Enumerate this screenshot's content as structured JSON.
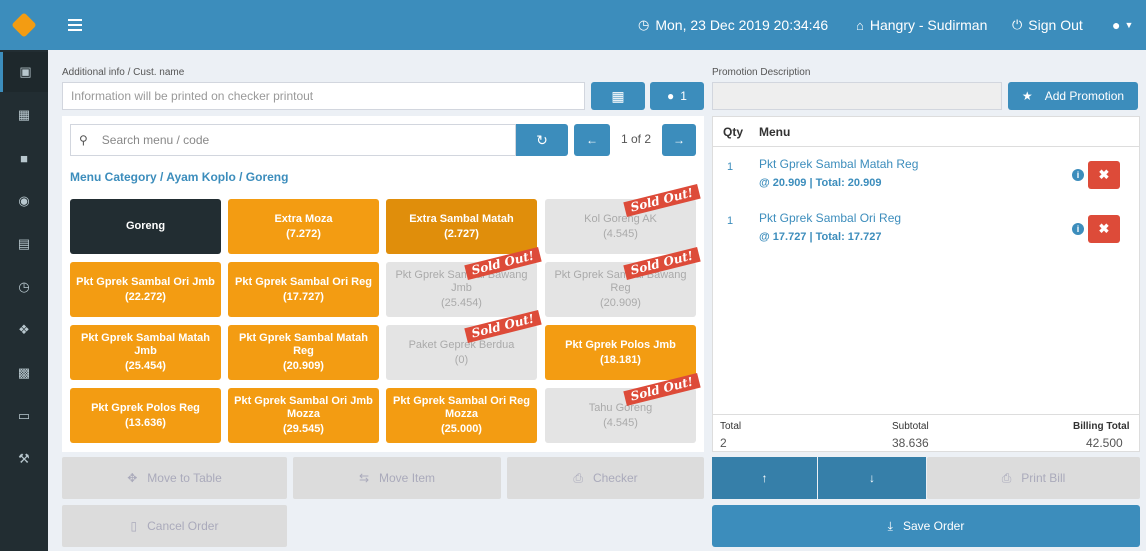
{
  "header": {
    "datetime": "Mon, 23 Dec 2019 20:34:46",
    "store": "Hangry - Sudirman",
    "signout": "Sign Out"
  },
  "sidebar_icons": [
    "table-icon",
    "keyboard-icon",
    "book-icon",
    "camera-icon",
    "card-icon",
    "clock-icon",
    "tag-icon",
    "receipt-icon",
    "inbox-icon",
    "wrench-icon"
  ],
  "customer": {
    "label": "Additional info / Cust. name",
    "placeholder": "Information will be printed on checker printout",
    "guest_count": "1"
  },
  "promotion": {
    "label": "Promotion Description",
    "add_label": "Add Promotion"
  },
  "search": {
    "placeholder": "Search menu / code",
    "page": "1 of 2"
  },
  "breadcrumb": "Menu Category  /  Ayam Koplo  /  Goreng",
  "sold_out_label": "Sold Out!",
  "menu_items": [
    {
      "name": "Goreng",
      "price": "",
      "state": "category"
    },
    {
      "name": "Extra Moza",
      "price": "(7.272)",
      "state": "available"
    },
    {
      "name": "Extra Sambal Matah",
      "price": "(2.727)",
      "state": "selected"
    },
    {
      "name": "Kol Goreng AK",
      "price": "(4.545)",
      "state": "soldout"
    },
    {
      "name": "Pkt Gprek Sambal Ori Jmb",
      "price": "(22.272)",
      "state": "available"
    },
    {
      "name": "Pkt Gprek Sambal Ori Reg",
      "price": "(17.727)",
      "state": "available"
    },
    {
      "name": "Pkt Gprek Sambal Bawang Jmb",
      "price": "(25.454)",
      "state": "soldout"
    },
    {
      "name": "Pkt Gprek Sambal Bawang Reg",
      "price": "(20.909)",
      "state": "soldout"
    },
    {
      "name": "Pkt Gprek Sambal Matah Jmb",
      "price": "(25.454)",
      "state": "available"
    },
    {
      "name": "Pkt Gprek Sambal Matah Reg",
      "price": "(20.909)",
      "state": "available"
    },
    {
      "name": "Paket Geprek Berdua",
      "price": "(0)",
      "state": "soldout"
    },
    {
      "name": "Pkt Gprek Polos Jmb",
      "price": "(18.181)",
      "state": "available"
    },
    {
      "name": "Pkt Gprek Polos Reg",
      "price": "(13.636)",
      "state": "available"
    },
    {
      "name": "Pkt Gprek Sambal Ori Jmb Mozza",
      "price": "(29.545)",
      "state": "available"
    },
    {
      "name": "Pkt Gprek Sambal Ori Reg Mozza",
      "price": "(25.000)",
      "state": "available"
    },
    {
      "name": "Tahu Goreng",
      "price": "(4.545)",
      "state": "soldout"
    }
  ],
  "actions": {
    "move_table": "Move to Table",
    "move_item": "Move Item",
    "checker": "Checker",
    "cancel": "Cancel Order",
    "print_bill": "Print Bill",
    "save": "Save Order"
  },
  "order": {
    "col_qty": "Qty",
    "col_menu": "Menu",
    "items": [
      {
        "qty": "1",
        "name": "Pkt Gprek Sambal Matah Reg",
        "price": "@ 20.909 | Total: 20.909"
      },
      {
        "qty": "1",
        "name": "Pkt Gprek Sambal Ori Reg",
        "price": "@ 17.727 | Total: 17.727"
      }
    ],
    "total_label": "Total",
    "total": "2",
    "subtotal_label": "Subtotal",
    "subtotal": "38.636",
    "billing_label": "Billing Total",
    "billing": "42.500"
  },
  "colors": {
    "primary": "#3c8dbc",
    "accent": "#f39c12",
    "danger": "#dd4b39",
    "sidebar": "#222d32"
  }
}
